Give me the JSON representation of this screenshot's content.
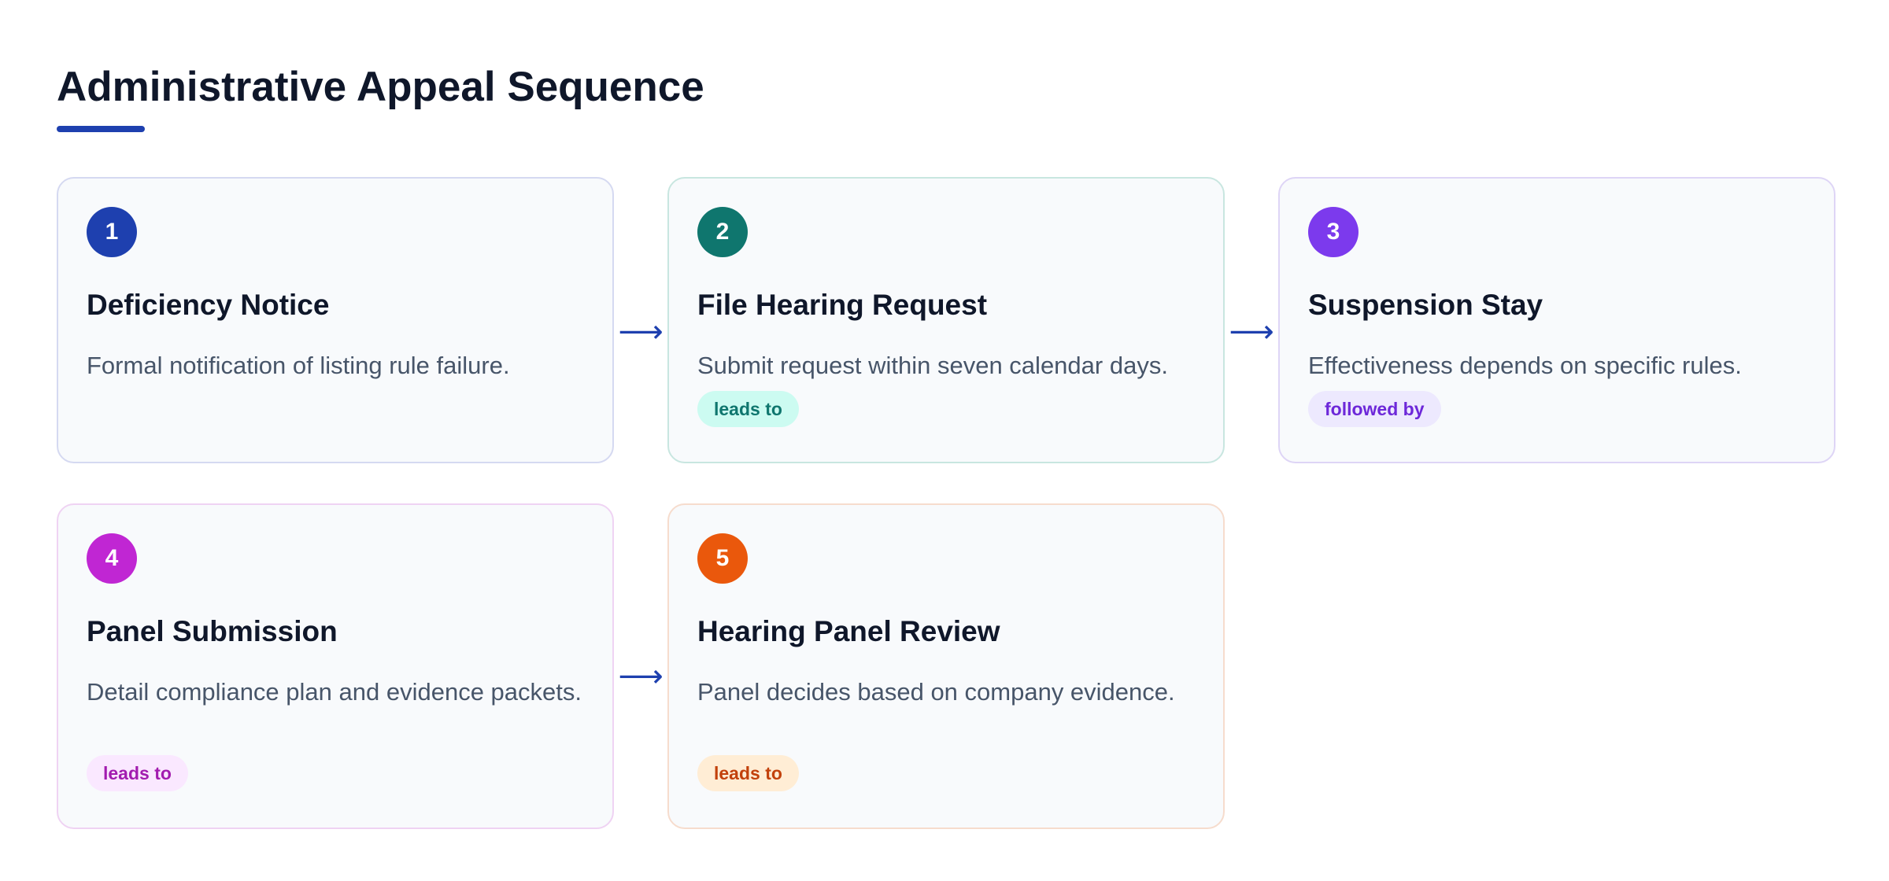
{
  "header": {
    "title": "Administrative Appeal Sequence",
    "underline_color": "#1e40af"
  },
  "steps": [
    {
      "number": "1",
      "title": "Deficiency Notice",
      "description": "Formal notification of listing rule failure.",
      "badge": "",
      "accent": "#1e40af",
      "border": "#d5d9f1"
    },
    {
      "number": "2",
      "title": "File Hearing Request",
      "description": "Submit request within seven calendar days.",
      "badge": "leads to",
      "accent": "#0f766e",
      "border": "#c8e6e0",
      "badge_bg": "#ccfbf1",
      "badge_color": "#0f766e"
    },
    {
      "number": "3",
      "title": "Suspension Stay",
      "description": "Effectiveness depends on specific rules.",
      "badge": "followed by",
      "accent": "#7c3aed",
      "border": "#ded5f6",
      "badge_bg": "#ede9fe",
      "badge_color": "#6d28d9"
    },
    {
      "number": "4",
      "title": "Panel Submission",
      "description": "Detail compliance plan and evidence packets.",
      "badge": "leads to",
      "accent": "#c026d3",
      "border": "#efd3f3",
      "badge_bg": "#fae8ff",
      "badge_color": "#a21caf"
    },
    {
      "number": "5",
      "title": "Hearing Panel Review",
      "description": "Panel decides based on company evidence.",
      "badge": "leads to",
      "accent": "#ea580c",
      "border": "#f6dccd",
      "badge_bg": "#ffedd5",
      "badge_color": "#c2410c"
    }
  ],
  "connectors": [
    {
      "from": "1",
      "to": "2",
      "symbol": "⟶"
    },
    {
      "from": "2",
      "to": "3",
      "symbol": "⟶"
    },
    {
      "from": "4",
      "to": "5",
      "symbol": "⟶"
    }
  ]
}
